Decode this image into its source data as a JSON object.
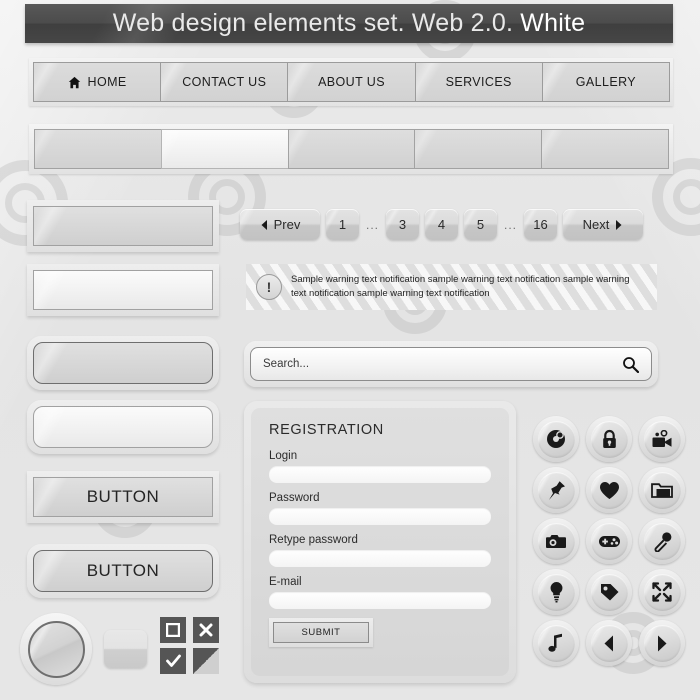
{
  "header": {
    "title_main": "Web design elements set. Web 2.0.",
    "title_highlight": "White"
  },
  "nav": {
    "items": [
      {
        "label": "HOME",
        "icon": "home-icon"
      },
      {
        "label": "CONTACT US",
        "icon": ""
      },
      {
        "label": "ABOUT US",
        "icon": ""
      },
      {
        "label": "SERVICES",
        "icon": ""
      },
      {
        "label": "GALLERY",
        "icon": ""
      }
    ]
  },
  "tabs": {
    "cells": [
      {
        "label": "",
        "active": false
      },
      {
        "label": "",
        "active": true
      },
      {
        "label": "",
        "active": false
      },
      {
        "label": "",
        "active": false
      },
      {
        "label": "",
        "active": false
      }
    ]
  },
  "left_column": {
    "boxes": [
      {
        "label": "",
        "style": "square-dark"
      },
      {
        "label": "",
        "style": "square-light"
      },
      {
        "label": "",
        "style": "rounded-dark"
      },
      {
        "label": "",
        "style": "rounded-light"
      },
      {
        "label": "BUTTON",
        "style": "square-button"
      },
      {
        "label": "BUTTON",
        "style": "rounded-button"
      }
    ],
    "knob_name": "round-knob",
    "small_tab_name": "small-tab-shape",
    "checkboxes": [
      {
        "state": "square-outline",
        "icon": "stop-icon"
      },
      {
        "state": "cross",
        "icon": "close-icon"
      },
      {
        "state": "checked",
        "icon": "check-icon"
      },
      {
        "state": "split",
        "icon": "half-filled-icon"
      }
    ]
  },
  "pagination": {
    "prev_label": "Prev",
    "next_label": "Next",
    "pages": [
      "1",
      "...",
      "3",
      "4",
      "5",
      "...",
      "16"
    ]
  },
  "warning": {
    "icon": "exclamation-icon",
    "text": "Sample warning text notification sample warning text notification sample warning text notification sample warning text notification"
  },
  "search": {
    "placeholder": "Search...",
    "value": "",
    "icon": "search-icon"
  },
  "registration": {
    "title": "REGISTRATION",
    "fields": [
      {
        "label": "Login",
        "value": ""
      },
      {
        "label": "Password",
        "value": ""
      },
      {
        "label": "Retype password",
        "value": ""
      },
      {
        "label": "E-mail",
        "value": ""
      }
    ],
    "submit_label": "SUBMIT"
  },
  "icon_grid": {
    "icons": [
      {
        "name": "disc-icon"
      },
      {
        "name": "lock-icon"
      },
      {
        "name": "video-camera-icon"
      },
      {
        "name": "pushpin-icon"
      },
      {
        "name": "heart-icon"
      },
      {
        "name": "folder-icon"
      },
      {
        "name": "camera-icon"
      },
      {
        "name": "gamepad-icon"
      },
      {
        "name": "microphone-icon"
      },
      {
        "name": "lightbulb-icon"
      },
      {
        "name": "tag-icon"
      },
      {
        "name": "fullscreen-icon"
      },
      {
        "name": "music-note-icon"
      },
      {
        "name": "arrow-left-icon"
      },
      {
        "name": "arrow-right-icon"
      }
    ]
  },
  "colors": {
    "background": "#e6e6e6",
    "titlebar": "#4a4a4a",
    "title_text": "#e9e9e9",
    "border": "#9b9b9b",
    "icon_glyph": "#1a1a1a"
  }
}
